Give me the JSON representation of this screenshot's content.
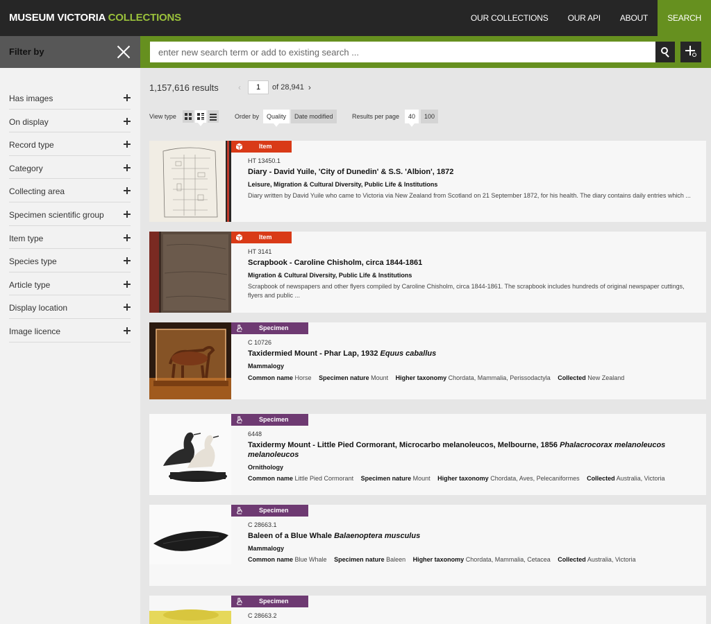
{
  "header": {
    "logo_main": "MUSEUM VICTORIA",
    "logo_accent": "COLLECTIONS",
    "nav": [
      {
        "label": "OUR COLLECTIONS"
      },
      {
        "label": "OUR API"
      },
      {
        "label": "ABOUT"
      },
      {
        "label": "SEARCH",
        "active": true
      }
    ]
  },
  "filter": {
    "title": "Filter by",
    "facets": [
      "Has images",
      "On display",
      "Record type",
      "Category",
      "Collecting area",
      "Specimen scientific group",
      "Item type",
      "Species type",
      "Article type",
      "Display location",
      "Image licence"
    ]
  },
  "search": {
    "placeholder": "enter new search term or add to existing search ..."
  },
  "results": {
    "count": "1,157,616 results",
    "page": "1",
    "of_pages": "of 28,941",
    "prev": "‹",
    "next": "›"
  },
  "controls": {
    "view_type_label": "View type",
    "order_label": "Order by",
    "order_options": [
      "Quality",
      "Date modified"
    ],
    "per_page_label": "Results per page",
    "per_page_options": [
      "40",
      "100"
    ]
  },
  "colors": {
    "item_badge": "#d93a17",
    "specimen_badge": "#6e3a72",
    "brand_green": "#66901f",
    "logo_accent": "#9ac13b"
  },
  "cards": [
    {
      "type": "Item",
      "icon": "box-icon",
      "reg": "HT 13450.1",
      "title": "Diary - David Yuile, 'City of Dunedin' & S.S. 'Albion', 1872",
      "sub": "Leisure, Migration & Cultural Diversity, Public Life & Institutions",
      "desc": "Diary written by David Yuile who came to Victoria via New Zealand from Scotland on 21 September 1872, for his health. The diary contains daily entries which ..."
    },
    {
      "type": "Item",
      "icon": "box-icon",
      "reg": "HT 3141",
      "title": "Scrapbook - Caroline Chisholm, circa 1844-1861",
      "sub": "Migration & Cultural Diversity, Public Life & Institutions",
      "desc": "Scrapbook of newspapers and other flyers compiled by Caroline Chisholm, circa 1844-1861. The scrapbook includes hundreds of original newspaper cuttings, flyers and public ..."
    },
    {
      "type": "Specimen",
      "icon": "microscope-icon",
      "reg": "C 10726",
      "title": "Taxidermied Mount - Phar Lap, 1932",
      "title_italic": "Equus caballus",
      "sub": "Mammalogy",
      "meta": [
        {
          "k": "Common name",
          "v": "Horse"
        },
        {
          "k": "Specimen nature",
          "v": "Mount"
        },
        {
          "k": "Higher taxonomy",
          "v": "Chordata, Mammalia, Perissodactyla"
        },
        {
          "k": "Collected",
          "v": "New Zealand"
        }
      ]
    },
    {
      "type": "Specimen",
      "icon": "microscope-icon",
      "reg": "6448",
      "title": "Taxidermy Mount - Little Pied Cormorant, Microcarbo melanoleucos, Melbourne, 1856",
      "title_italic": "Phalacrocorax melanoleucos melanoleucos",
      "sub": "Ornithology",
      "meta": [
        {
          "k": "Common name",
          "v": "Little Pied Cormorant"
        },
        {
          "k": "Specimen nature",
          "v": "Mount"
        },
        {
          "k": "Higher taxonomy",
          "v": "Chordata, Aves, Pelecaniformes"
        },
        {
          "k": "Collected",
          "v": "Australia, Victoria"
        }
      ]
    },
    {
      "type": "Specimen",
      "icon": "microscope-icon",
      "reg": "C 28663.1",
      "title": "Baleen of a Blue Whale",
      "title_italic": "Balaenoptera musculus",
      "sub": "Mammalogy",
      "meta": [
        {
          "k": "Common name",
          "v": "Blue Whale"
        },
        {
          "k": "Specimen nature",
          "v": "Baleen"
        },
        {
          "k": "Higher taxonomy",
          "v": "Chordata, Mammalia, Cetacea"
        },
        {
          "k": "Collected",
          "v": "Australia, Victoria"
        }
      ]
    },
    {
      "type": "Specimen",
      "icon": "microscope-icon",
      "reg": "C 28663.2"
    }
  ]
}
